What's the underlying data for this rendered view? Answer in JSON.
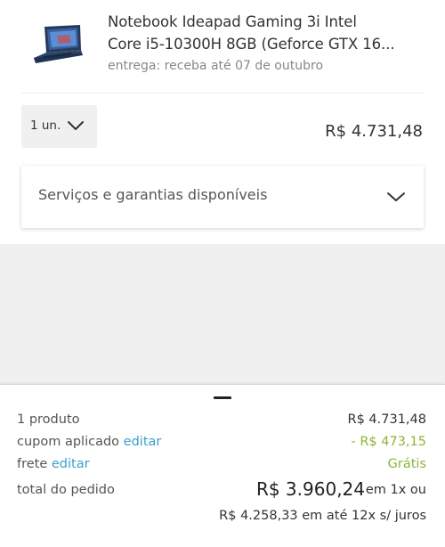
{
  "product": {
    "name_line1": "Notebook Ideapad Gaming 3i Intel",
    "name_line2": "Core i5-10300H 8GB (Geforce GTX 16...",
    "delivery": "entrega: receba até 07 de outubro",
    "thumbnail_icon": "laptop-icon",
    "quantity": "1 un.",
    "price": "R$ 4.731,48"
  },
  "services": {
    "label": "Serviços e garantias disponíveis"
  },
  "summary": {
    "products_label": "1 produto",
    "products_value": "R$ 4.731,48",
    "coupon_label": "cupom aplicado",
    "coupon_edit": "editar",
    "coupon_value": "- R$ 473,15",
    "shipping_label": "frete",
    "shipping_edit": "editar",
    "shipping_value": "Grátis",
    "total_label": "total do pedido",
    "total_value": "R$ 3.960,24",
    "total_suffix": "em 1x ou",
    "installments": "R$ 4.258,33 em até 12x s/ juros"
  },
  "colors": {
    "link": "#3aa0c9",
    "discount": "#8cb53a",
    "background": "#f0f0f0"
  }
}
